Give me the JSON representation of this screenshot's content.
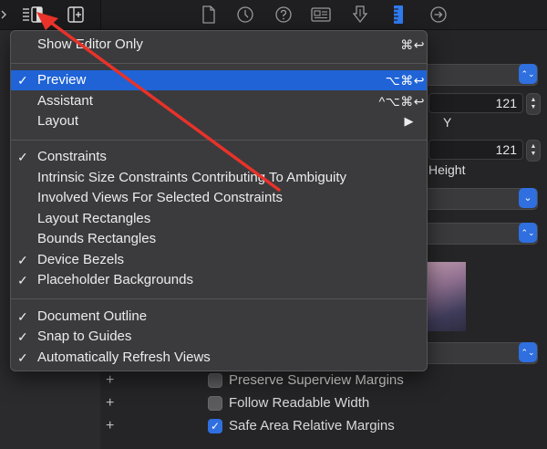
{
  "menu": {
    "sections": [
      {
        "items": [
          {
            "label": "Show Editor Only",
            "shortcut": "⌘↩",
            "checked": false,
            "selected": false,
            "submenu": false
          }
        ]
      },
      {
        "items": [
          {
            "label": "Preview",
            "shortcut": "⌥⌘↩",
            "checked": true,
            "selected": true,
            "submenu": false
          },
          {
            "label": "Assistant",
            "shortcut": "^⌥⌘↩",
            "checked": false,
            "selected": false,
            "submenu": false
          },
          {
            "label": "Layout",
            "shortcut": "▶",
            "checked": false,
            "selected": false,
            "submenu": true
          }
        ]
      },
      {
        "items": [
          {
            "label": "Constraints",
            "checked": true
          },
          {
            "label": "Intrinsic Size Constraints Contributing To Ambiguity",
            "checked": false
          },
          {
            "label": "Involved Views For Selected Constraints",
            "checked": false
          },
          {
            "label": "Layout Rectangles",
            "checked": false
          },
          {
            "label": "Bounds Rectangles",
            "checked": false
          },
          {
            "label": "Device Bezels",
            "checked": true
          },
          {
            "label": "Placeholder Backgrounds",
            "checked": true
          }
        ]
      },
      {
        "items": [
          {
            "label": "Document Outline",
            "checked": true
          },
          {
            "label": "Snap to Guides",
            "checked": true
          },
          {
            "label": "Automatically Refresh Views",
            "checked": true
          }
        ]
      }
    ],
    "check_glyph": "✓"
  },
  "inspector": {
    "x_value": "121",
    "y_label": "Y",
    "width_value": "121",
    "height_label": "Height",
    "popup_arrow_glyph": "⌃⌄",
    "checkboxes": [
      {
        "label": "Preserve Superview Margins",
        "checked": false
      },
      {
        "label": "Follow Readable Width",
        "checked": false
      },
      {
        "label": "Safe Area Relative Margins",
        "checked": true
      }
    ],
    "plus_glyph": "+"
  },
  "toolbar": {
    "icons": [
      "editor-options-icon",
      "add-editor-icon",
      "file-icon",
      "history-icon",
      "help-icon",
      "identity-icon",
      "attributes-icon",
      "size-ruler-icon",
      "connections-icon"
    ]
  },
  "colors": {
    "accent": "#1f63d6",
    "annotation_arrow": "#e8322a"
  }
}
